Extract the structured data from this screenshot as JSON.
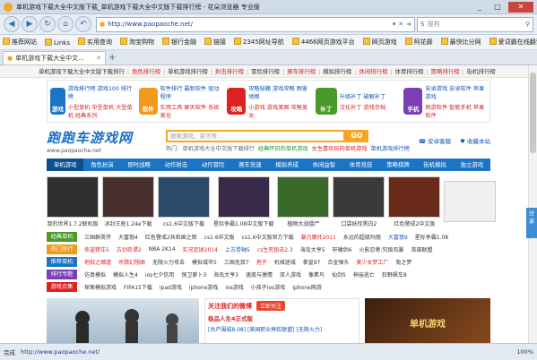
{
  "titlebar": {
    "title": "单机游戏下载大全中文版下载_单机游戏下载大全中文版下载排行榜 - 花朵浏览器 专业版",
    "controls": [
      "_",
      "□",
      "✕"
    ]
  },
  "navbar": {
    "address": "http://www.paopaoche.net/",
    "search_placeholder": "搜狗"
  },
  "favorites": [
    "推荐网站",
    "Links",
    "实用查询",
    "淘宝购物",
    "银行金融",
    "链接",
    "2345网址导航",
    "4466网页游戏平台",
    "网页游戏",
    "阿花藤",
    "最快比分网",
    "爱词霸在线翻译"
  ],
  "tab": {
    "label": "单机游戏下载大全中文..."
  },
  "topstrip": {
    "items": [
      {
        "t": "单机游戏下载大全中文版下载排行",
        "c": ""
      },
      {
        "t": "角色排行榜",
        "c": "red"
      },
      {
        "t": "单机游戏排行榜",
        "c": ""
      },
      {
        "t": "射击排行榜",
        "c": "red"
      },
      {
        "t": "冒险排行榜",
        "c": ""
      },
      {
        "t": "赛车排行榜",
        "c": "red"
      },
      {
        "t": "模拟排行榜",
        "c": ""
      },
      {
        "t": "休闲排行榜",
        "c": "red"
      },
      {
        "t": "体育排行榜",
        "c": ""
      },
      {
        "t": "策略排行榜",
        "c": "red"
      },
      {
        "t": "街机排行榜",
        "c": ""
      }
    ]
  },
  "categories": [
    {
      "icon": "游戏",
      "color": "#1b74c4",
      "l1": "游戏排行榜  游戏100  排行榜",
      "l2": "小型单机  中型单机  大型单机  经典系列"
    },
    {
      "icon": "软件",
      "color": "#f39a1a",
      "l1": "软件排行  最新软件  驱动程序",
      "l2": "实用工具  聊天软件  系统美化"
    },
    {
      "icon": "攻略",
      "color": "#d22",
      "l1": "攻略秘籍  游戏攻略  图鉴地图",
      "l2": "小游戏  游戏美图  攻略美女"
    },
    {
      "icon": "补丁",
      "color": "#4a9a2a",
      "l1": "升级补丁  破解补丁",
      "l2": "汉化补丁  游戏存档"
    },
    {
      "icon": "手机",
      "color": "#7a3fb5",
      "l1": "安卓游戏  安卓软件  苹果游戏",
      "l2": "网游软件  智能手机  苹果软件"
    }
  ],
  "logo": {
    "main": "跑跑车游戏网",
    "url": "www.paopaoche.net"
  },
  "site_search": {
    "placeholder": "搜索游戏、资讯等...",
    "go": "GO",
    "hot_label": "热门:",
    "hot": [
      {
        "t": "单机游戏大全中文版下载排行",
        "c": ""
      },
      {
        "t": "经典怀旧的单机游戏",
        "c": "g"
      },
      {
        "t": "女生喜欢玩的单机游戏",
        "c": "r"
      },
      {
        "t": "单机游戏排行榜",
        "c": "b"
      }
    ]
  },
  "logo_right": [
    "安卓客服",
    "收藏本站"
  ],
  "mainnav": [
    "单机游戏",
    "角色扮演",
    "即时战略",
    "动作射击",
    "动作冒险",
    "赛车竞速",
    "模拟养成",
    "休闲益智",
    "体育竞技",
    "策略棋牌",
    "街机模拟",
    "独立游戏"
  ],
  "games": [
    {
      "name": "我的世界1.7.2联机版",
      "bg": "#2f2f2f"
    },
    {
      "name": "冰封王座1.24e下载",
      "bg": "#4a2f2f"
    },
    {
      "name": "cs1.6中文版下载",
      "bg": "#2a4a6a"
    },
    {
      "name": "星际争霸1.08中文版下载",
      "bg": "#3a2a4a"
    },
    {
      "name": "植物大战僵尸",
      "bg": "#3a6a2a"
    },
    {
      "name": "口袋妖怪黑白2",
      "bg": "#3a3a3a"
    },
    {
      "name": "红色警戒2中文版",
      "bg": "#6a2a1a"
    },
    {
      "name": "",
      "bg": "#f0f0f0"
    }
  ],
  "rankrows": [
    {
      "tag": "经典单机",
      "tagcolor": "#4a9a2a",
      "items": [
        [
          "三国群英传",
          ""
        ],
        [
          "大富翁4",
          ""
        ],
        [
          "红色警戒2共和国之辉",
          ""
        ],
        [
          "cs1.6中文版",
          ""
        ],
        [
          "cs1.6中文版官方下载",
          ""
        ],
        [
          "暴力摩托2011",
          "red"
        ],
        [
          "永远的超级玛丽",
          ""
        ],
        [
          "大富翁9",
          "blue"
        ],
        [
          "星际争霸1.08",
          ""
        ]
      ]
    },
    {
      "tag": "热门排行",
      "tagcolor": "#f39a1a",
      "items": [
        [
          "侠盗猎车5",
          "red"
        ],
        [
          "古剑奇谭2",
          "red"
        ],
        [
          "NBA 2K14",
          ""
        ],
        [
          "实况足球2014",
          "red"
        ],
        [
          "上古卷轴5",
          "blue"
        ],
        [
          "cs生死狙击2.3",
          "red"
        ],
        [
          "海岛大亨5",
          ""
        ],
        [
          "轩辕剑6",
          ""
        ],
        [
          "火影忍者:究极风暴",
          ""
        ],
        [
          "英雄联盟",
          ""
        ]
      ]
    },
    {
      "tag": "推荐单机",
      "tagcolor": "#1b74c4",
      "items": [
        [
          "地狱之肆虐",
          "red"
        ],
        [
          "杀戮幻想曲",
          "red"
        ],
        [
          "无限火力攻击",
          ""
        ],
        [
          "模拟城市5",
          ""
        ],
        [
          "三国无双7",
          ""
        ],
        [
          "孢子",
          "red"
        ],
        [
          "机械迷城",
          ""
        ],
        [
          "拳皇97",
          ""
        ],
        [
          "合金弹头",
          ""
        ],
        [
          "美少女梦工厂",
          "red"
        ],
        [
          "兔之梦",
          ""
        ]
      ]
    },
    {
      "tag": "排行专题",
      "tagcolor": "#7a3fb5",
      "items": [
        [
          "仿真模拟",
          ""
        ],
        [
          "模拟人生4",
          ""
        ],
        [
          "ios七夕信用",
          ""
        ],
        [
          "保卫萝卜3",
          ""
        ],
        [
          "海岛大亨3",
          ""
        ],
        [
          "速度与激情",
          ""
        ],
        [
          "双人游戏",
          ""
        ],
        [
          "像素鸟",
          ""
        ],
        [
          "仙剑5",
          ""
        ],
        [
          "神庙逃亡",
          ""
        ],
        [
          "狂野飙车8",
          ""
        ]
      ]
    },
    {
      "tag": "游戏合集",
      "tagcolor": "#d22",
      "items": [
        [
          "探索模拟游戏",
          ""
        ],
        [
          "FIFA15下载",
          ""
        ],
        [
          "ipad游戏",
          ""
        ],
        [
          "iphone游戏",
          ""
        ],
        [
          "ios游戏",
          ""
        ],
        [
          "小孩子ios游戏",
          ""
        ],
        [
          "iphone网游",
          ""
        ]
      ]
    }
  ],
  "banner2": {
    "weibo": "关注我们的微博",
    "follow": "立即关注",
    "sub": "极品人生4正式版",
    "line": "[共产围城8.08]  [美国职业摔跤联盟]  [无限火力]"
  },
  "banner3": {
    "title": "单机游戏"
  },
  "sharetab": "分享",
  "status": {
    "ready": "完成",
    "url": "http://www.paopaoche.net/",
    "zoom": "100%"
  }
}
